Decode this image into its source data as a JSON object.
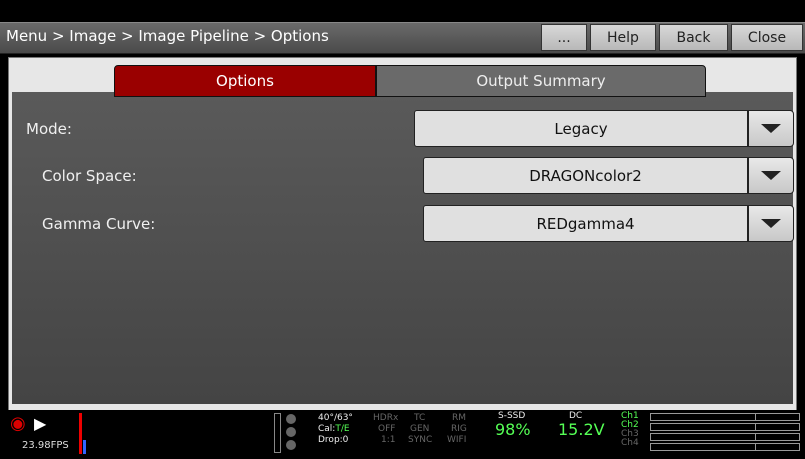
{
  "header": {
    "breadcrumb": "Menu > Image > Image Pipeline > Options",
    "buttons": {
      "more": "...",
      "help": "Help",
      "back": "Back",
      "close": "Close"
    }
  },
  "tabs": [
    {
      "label": "Options",
      "active": true
    },
    {
      "label": "Output Summary",
      "active": false
    }
  ],
  "settings": {
    "mode": {
      "label": "Mode:",
      "value": "Legacy"
    },
    "color_space": {
      "label": "Color Space:",
      "value": "DRAGONcolor2"
    },
    "gamma_curve": {
      "label": "Gamma Curve:",
      "value": "REDgamma4"
    }
  },
  "status": {
    "fps": "23.98FPS",
    "temp": "40°/63°",
    "cal": "Cal:",
    "cal_value": "T/E",
    "drop": "Drop:0",
    "hdrx": "HDRx",
    "hdrx_val": "OFF",
    "hdrx_ratio": "1:1",
    "tc": "TC",
    "tc_gen": "GEN",
    "tc_sync": "SYNC",
    "rm": "RM",
    "rm_rig": "RIG",
    "rm_wifi": "WIFI",
    "media_label": "S-SSD",
    "media_pct": "98%",
    "dc_label": "DC",
    "dc_value": "15.2V",
    "ch1": "Ch1",
    "ch2": "Ch2",
    "ch3": "Ch3",
    "ch4": "Ch4"
  },
  "colors": {
    "accent_red": "#9a0000",
    "green": "#55ff55"
  },
  "icons": {
    "record": "camera-record-icon",
    "play": "play-icon",
    "dropdown": "caret-down-icon"
  }
}
